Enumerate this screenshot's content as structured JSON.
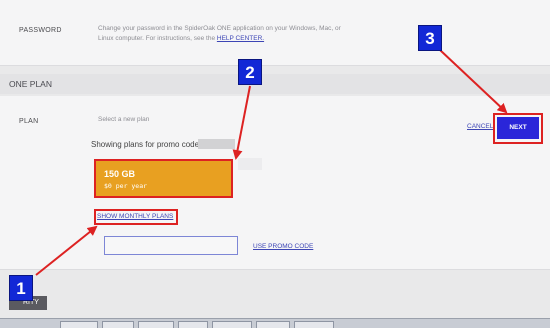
{
  "password": {
    "label": "PASSWORD",
    "help_text": "Change your password in the SpiderOak ONE application on your Windows, Mac, or",
    "help_text_2": "Linux computer. For instructions, see the",
    "help_link": "HELP CENTER."
  },
  "one_plan": {
    "title": "ONE PLAN",
    "plan_label": "PLAN",
    "select_prompt": "Select a new plan",
    "promo_text": "Showing plans for promo code:",
    "plan_card": {
      "size": "150 GB",
      "price": "$0 per year"
    },
    "show_monthly": "SHOW MONTHLY PLANS",
    "promo_input_value": "",
    "use_promo": "USE PROMO CODE",
    "cancel": "CANCEL",
    "next": "NEXT"
  },
  "bottom_section_title": "RITY",
  "annotations": {
    "badge_1": "1",
    "badge_2": "2",
    "badge_3": "3"
  },
  "colors": {
    "accent": "#2a26d9",
    "plan_card": "#e8a021",
    "annotation_red": "#dd2222",
    "badge_blue": "#1228d6"
  }
}
